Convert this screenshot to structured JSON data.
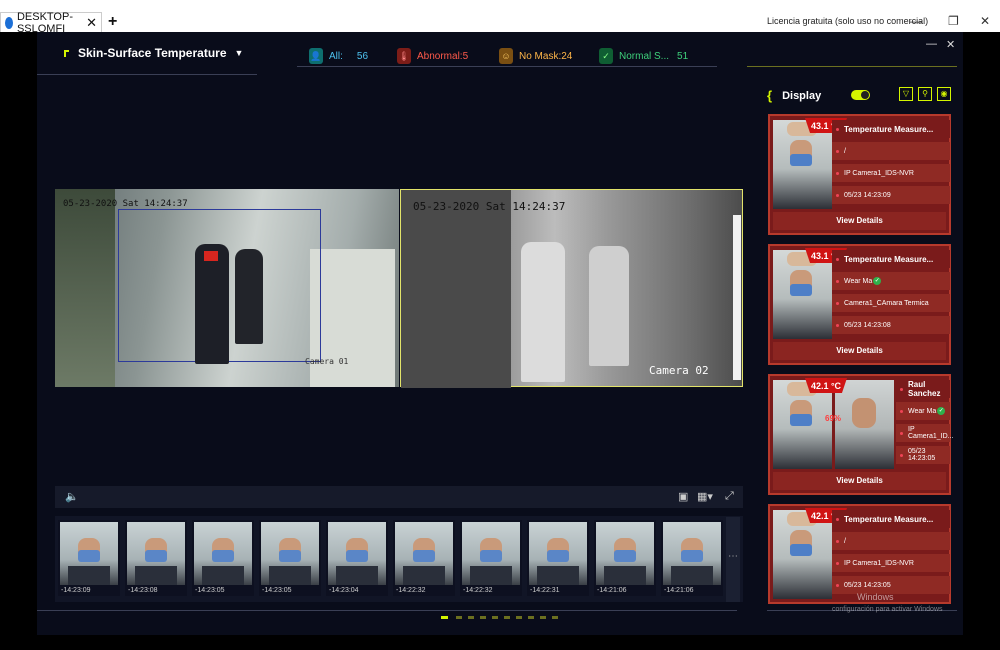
{
  "window": {
    "tab_title": "DESKTOP-SSLOMFI",
    "license": "Licencia gratuita (solo uso no comercial)"
  },
  "app": {
    "title": "Skin-Surface Temperature",
    "stats": {
      "all_label": "All:",
      "all_value": "56",
      "abnormal": "Abnormal:5",
      "nomask": "No Mask:24",
      "normal_label": "Normal S...",
      "normal_value": "51"
    },
    "display_label": "Display"
  },
  "viewer": {
    "cam1_timestamp": "05-23-2020 Sat 14:24:37",
    "cam1_label": "Camera 01",
    "cam2_timestamp": "05-23-2020 Sat 14:24:37",
    "cam2_label": "Camera 02"
  },
  "thumbnails": [
    {
      "time": "-14:23:09"
    },
    {
      "time": "-14:23:08"
    },
    {
      "time": "-14:23:05"
    },
    {
      "time": "-14:23:05"
    },
    {
      "time": "-14:23:04"
    },
    {
      "time": "-14:22:32"
    },
    {
      "time": "-14:22:32"
    },
    {
      "time": "-14:22:31"
    },
    {
      "time": "-14:21:06"
    },
    {
      "time": "-14:21:06"
    }
  ],
  "cards": [
    {
      "temp": "43.1 °C",
      "title": "Temperature Measure...",
      "mask": "/",
      "camera": "IP Camera1_IDS-NVR",
      "time": "05/23 14:23:09",
      "button": "View Details"
    },
    {
      "temp": "43.1 °C",
      "title": "Temperature Measure...",
      "mask": "Wear Ma",
      "camera": "Camera1_CAmara Termica",
      "time": "05/23 14:23:08",
      "button": "View Details"
    },
    {
      "temp": "42.1 °C",
      "title": "Raul Sanchez",
      "mask": "Wear Ma",
      "camera": "IP Camera1_ID...",
      "time": "05/23 14:23:05",
      "button": "View Details",
      "score": "69%"
    },
    {
      "temp": "42.1 °C",
      "title": "Temperature Measure...",
      "mask": "/",
      "camera": "IP Camera1_IDS-NVR",
      "time": "05/23 14:23:05"
    }
  ],
  "watermark": {
    "line1": "Windows",
    "line2": "configuración para activar Windows"
  },
  "colors": {
    "accent": "#d4f500",
    "alarm": "#d01414",
    "card": "#7a1b1b",
    "bg": "#090c1a"
  }
}
